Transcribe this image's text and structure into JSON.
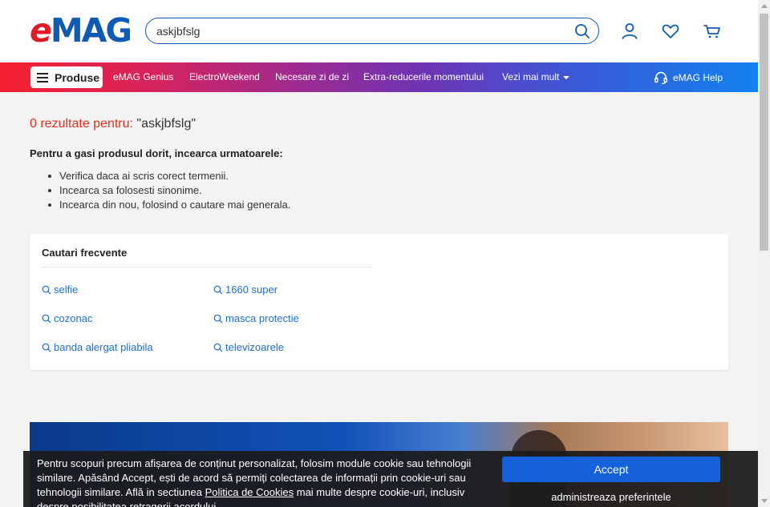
{
  "header": {
    "logo": "eMAG",
    "search": {
      "value": "askjbfslg",
      "placeholder": ""
    },
    "icons": [
      "search-icon",
      "user-icon",
      "heart-icon",
      "cart-icon"
    ]
  },
  "nav": {
    "products_label": "Produse",
    "links": [
      "eMAG Genius",
      "ElectroWeekend",
      "Necesare zi de zi",
      "Extra-reducerile momentului",
      "Vezi mai mult"
    ],
    "help_label": "eMAG Help"
  },
  "results": {
    "count_text": "0 rezultate pentru:",
    "query_text": "\"askjbfslg\"",
    "tips_heading": "Pentru a gasi produsul dorit, incearca urmatoarele:",
    "tips": [
      "Verifica daca ai scris corect termenii.",
      "Incearca sa folosesti sinonime.",
      "Incearca din nou, folosind o cautare mai generala."
    ]
  },
  "frequent": {
    "title": "Cautari frecvente",
    "items": [
      "selfie",
      "1660 super",
      "cozonac",
      "masca protectie",
      "banda alergat pliabila",
      "televizoarele"
    ]
  },
  "cookie": {
    "text_before": "Pentru scopuri precum afișarea de conținut personalizat, folosim module cookie sau tehnologii similare. Apăsând Accept, ești de acord să permiți colectarea de informații prin cookie-uri sau tehnologii similare. Află in sectiunea ",
    "link": "Politica de Cookies",
    "text_after": " mai multe despre cookie-uri, inclusiv despre posibilitatea retragerii acordului.",
    "accept_label": "Accept",
    "prefs_label": "administreaza preferintele"
  },
  "colors": {
    "brand_red": "#e21a25",
    "brand_blue": "#0f5ab4",
    "link_blue": "#1f6fc5",
    "result_red": "#e0301e",
    "accept_blue": "#1461d9"
  }
}
